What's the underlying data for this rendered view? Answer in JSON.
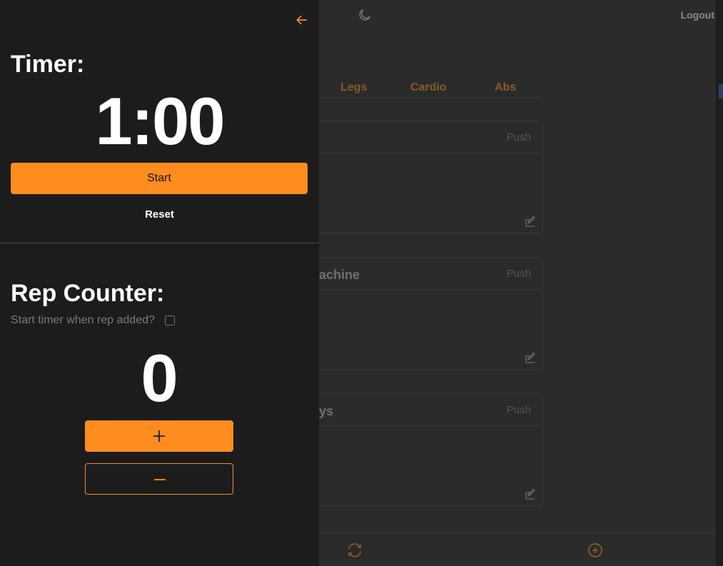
{
  "header": {
    "logout_label": "Logout",
    "theme_icon": "moon-icon"
  },
  "tabs": [
    {
      "label": "Legs"
    },
    {
      "label": "Cardio"
    },
    {
      "label": "Abs"
    }
  ],
  "cards": [
    {
      "name": "",
      "tag": "Push"
    },
    {
      "name": "achine",
      "tag": "Push"
    },
    {
      "name": "ys",
      "tag": "Push"
    }
  ],
  "bottom_bar": {
    "left_icon": "refresh-icon",
    "right_icon": "plus-circle-icon"
  },
  "timer": {
    "heading": "Timer:",
    "display": "1:00",
    "start_label": "Start",
    "reset_label": "Reset"
  },
  "rep_counter": {
    "heading": "Rep Counter:",
    "auto_start_label": "Start timer when rep added?",
    "auto_start_checked": false,
    "count": "0"
  },
  "colors": {
    "accent": "#ff8c1f",
    "drawer_bg": "#1c1c1c",
    "page_bg": "#2b2b2b"
  }
}
